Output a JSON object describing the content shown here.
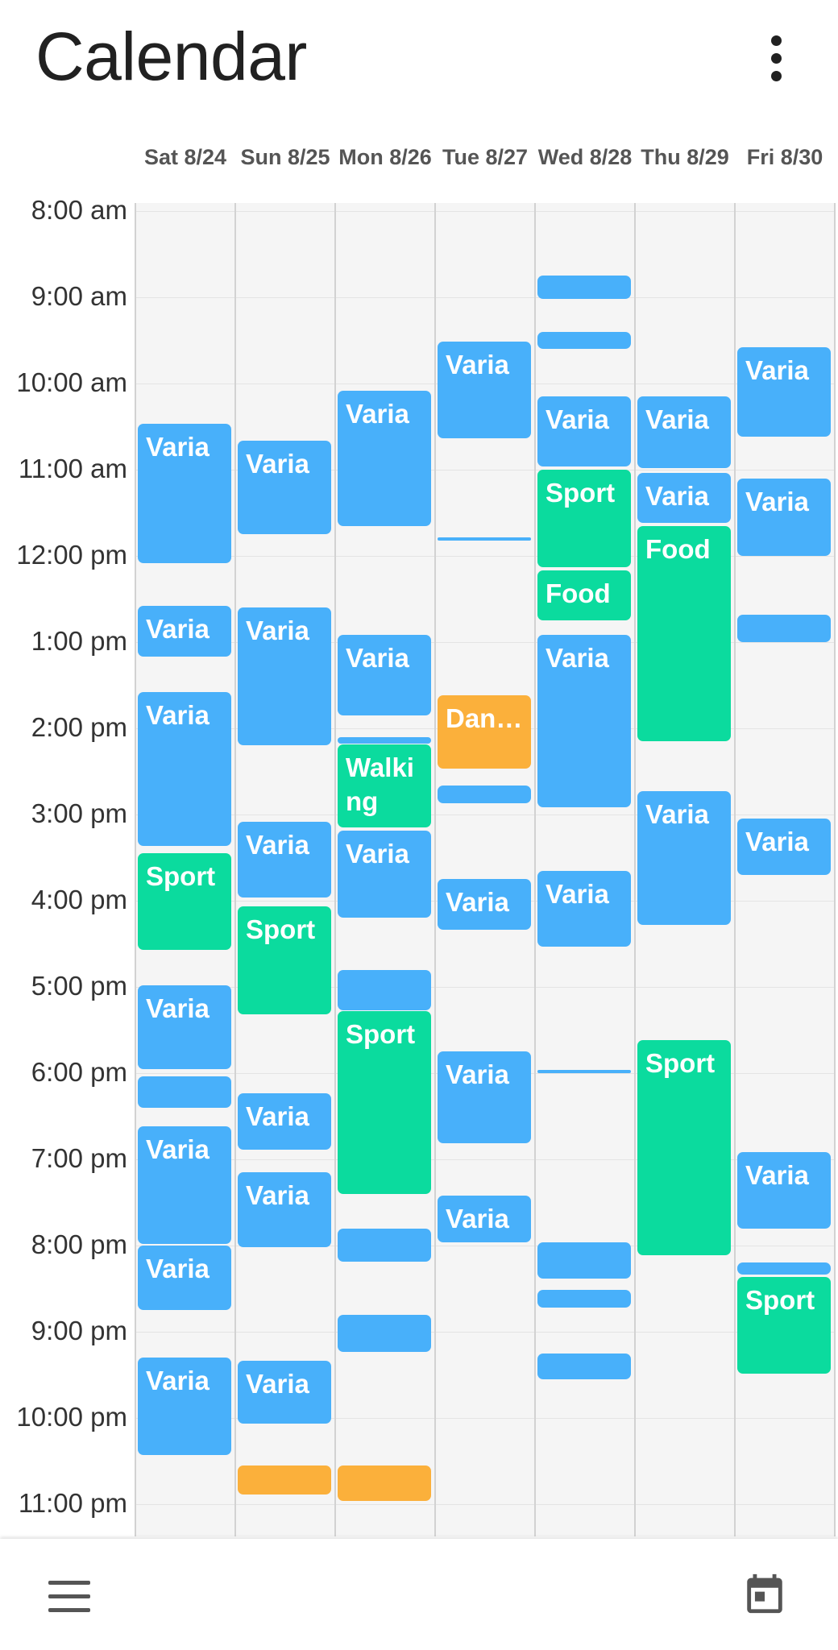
{
  "app": {
    "title": "Calendar"
  },
  "days": [
    "Sat 8/24",
    "Sun 8/25",
    "Mon 8/26",
    "Tue 8/27",
    "Wed 8/28",
    "Thu 8/29",
    "Fri 8/30"
  ],
  "hours": [
    "8:00 am",
    "9:00 am",
    "10:00 am",
    "11:00 am",
    "12:00 pm",
    "1:00 pm",
    "2:00 pm",
    "3:00 pm",
    "4:00 pm",
    "5:00 pm",
    "6:00 pm",
    "7:00 pm",
    "8:00 pm",
    "9:00 pm",
    "10:00 pm",
    "11:00 pm"
  ],
  "colors": {
    "blue": "#48b0fa",
    "green": "#0bdb9e",
    "orange": "#fbb03b"
  },
  "events": [
    {
      "day": 0,
      "start": "10:28",
      "end": "12:05",
      "label": "Varia",
      "color": "blue"
    },
    {
      "day": 0,
      "start": "12:35",
      "end": "13:10",
      "label": "Varia",
      "color": "blue"
    },
    {
      "day": 0,
      "start": "13:35",
      "end": "15:22",
      "label": "Varia",
      "color": "blue"
    },
    {
      "day": 0,
      "start": "15:27",
      "end": "16:34",
      "label": "Sport",
      "color": "green"
    },
    {
      "day": 0,
      "start": "16:59",
      "end": "17:57",
      "label": "Varia",
      "color": "blue"
    },
    {
      "day": 0,
      "start": "18:02",
      "end": "18:24",
      "label": "",
      "color": "blue"
    },
    {
      "day": 0,
      "start": "18:37",
      "end": "19:59",
      "label": "Varia",
      "color": "blue"
    },
    {
      "day": 0,
      "start": "20:00",
      "end": "20:45",
      "label": "Varia",
      "color": "blue"
    },
    {
      "day": 0,
      "start": "21:18",
      "end": "22:26",
      "label": "Varia",
      "color": "blue"
    },
    {
      "day": 1,
      "start": "10:40",
      "end": "11:45",
      "label": "Varia",
      "color": "blue"
    },
    {
      "day": 1,
      "start": "12:36",
      "end": "14:12",
      "label": "Varia",
      "color": "blue"
    },
    {
      "day": 1,
      "start": "15:05",
      "end": "15:58",
      "label": "Varia",
      "color": "blue"
    },
    {
      "day": 1,
      "start": "16:04",
      "end": "17:19",
      "label": "Sport",
      "color": "green"
    },
    {
      "day": 1,
      "start": "18:14",
      "end": "18:53",
      "label": "Varia",
      "color": "blue"
    },
    {
      "day": 1,
      "start": "19:09",
      "end": "20:01",
      "label": "Varia",
      "color": "blue"
    },
    {
      "day": 1,
      "start": "21:20",
      "end": "22:04",
      "label": "Varia",
      "color": "blue"
    },
    {
      "day": 1,
      "start": "22:33",
      "end": "22:53",
      "label": "",
      "color": "orange"
    },
    {
      "day": 2,
      "start": "10:05",
      "end": "11:39",
      "label": "Varia",
      "color": "blue"
    },
    {
      "day": 2,
      "start": "12:55",
      "end": "13:51",
      "label": "Varia",
      "color": "blue"
    },
    {
      "day": 2,
      "start": "14:06",
      "end": "14:09",
      "label": "",
      "color": "blue"
    },
    {
      "day": 2,
      "start": "14:11",
      "end": "15:09",
      "label": "Walking",
      "color": "green",
      "wrap": true
    },
    {
      "day": 2,
      "start": "15:11",
      "end": "16:12",
      "label": "Varia",
      "color": "blue"
    },
    {
      "day": 2,
      "start": "16:48",
      "end": "17:16",
      "label": "",
      "color": "blue"
    },
    {
      "day": 2,
      "start": "17:17",
      "end": "19:24",
      "label": "Sport",
      "color": "green"
    },
    {
      "day": 2,
      "start": "19:48",
      "end": "20:11",
      "label": "",
      "color": "blue"
    },
    {
      "day": 2,
      "start": "20:48",
      "end": "21:14",
      "label": "",
      "color": "blue"
    },
    {
      "day": 2,
      "start": "22:33",
      "end": "22:58",
      "label": "",
      "color": "orange"
    },
    {
      "day": 3,
      "start": "9:31",
      "end": "10:38",
      "label": "Varia",
      "color": "blue"
    },
    {
      "day": 3,
      "start": "11:47",
      "end": "11:49",
      "label": "",
      "color": "blue"
    },
    {
      "day": 3,
      "start": "13:37",
      "end": "14:28",
      "label": "Daniel",
      "color": "orange",
      "ellipsis": true
    },
    {
      "day": 3,
      "start": "14:40",
      "end": "14:52",
      "label": "",
      "color": "blue"
    },
    {
      "day": 3,
      "start": "15:45",
      "end": "16:20",
      "label": "Varia",
      "color": "blue"
    },
    {
      "day": 3,
      "start": "17:45",
      "end": "18:49",
      "label": "Varia",
      "color": "blue"
    },
    {
      "day": 3,
      "start": "19:25",
      "end": "19:58",
      "label": "Varia",
      "color": "blue"
    },
    {
      "day": 4,
      "start": "8:45",
      "end": "9:01",
      "label": "",
      "color": "blue"
    },
    {
      "day": 4,
      "start": "9:24",
      "end": "9:36",
      "label": "",
      "color": "blue"
    },
    {
      "day": 4,
      "start": "10:09",
      "end": "10:58",
      "label": "Varia",
      "color": "blue"
    },
    {
      "day": 4,
      "start": "11:00",
      "end": "12:08",
      "label": "Sport",
      "color": "green"
    },
    {
      "day": 4,
      "start": "12:10",
      "end": "12:45",
      "label": "Food",
      "color": "green"
    },
    {
      "day": 4,
      "start": "12:55",
      "end": "14:55",
      "label": "Varia",
      "color": "blue"
    },
    {
      "day": 4,
      "start": "15:39",
      "end": "16:32",
      "label": "Varia",
      "color": "blue"
    },
    {
      "day": 4,
      "start": "17:58",
      "end": "18:00",
      "label": "",
      "color": "blue"
    },
    {
      "day": 4,
      "start": "19:58",
      "end": "20:23",
      "label": "",
      "color": "blue"
    },
    {
      "day": 4,
      "start": "20:31",
      "end": "20:43",
      "label": "",
      "color": "blue"
    },
    {
      "day": 4,
      "start": "21:15",
      "end": "21:33",
      "label": "",
      "color": "blue"
    },
    {
      "day": 5,
      "start": "10:09",
      "end": "10:59",
      "label": "Varia",
      "color": "blue"
    },
    {
      "day": 5,
      "start": "11:02",
      "end": "11:37",
      "label": "Varia",
      "color": "blue"
    },
    {
      "day": 5,
      "start": "11:39",
      "end": "14:09",
      "label": "Food",
      "color": "green"
    },
    {
      "day": 5,
      "start": "14:44",
      "end": "16:17",
      "label": "Varia",
      "color": "blue"
    },
    {
      "day": 5,
      "start": "17:37",
      "end": "20:07",
      "label": "Sport",
      "color": "green"
    },
    {
      "day": 6,
      "start": "9:35",
      "end": "10:37",
      "label": "Varia",
      "color": "blue"
    },
    {
      "day": 6,
      "start": "11:06",
      "end": "12:00",
      "label": "Varia",
      "color": "blue"
    },
    {
      "day": 6,
      "start": "12:41",
      "end": "13:00",
      "label": "",
      "color": "blue"
    },
    {
      "day": 6,
      "start": "15:03",
      "end": "15:42",
      "label": "Varia",
      "color": "blue"
    },
    {
      "day": 6,
      "start": "18:55",
      "end": "19:48",
      "label": "Varia",
      "color": "blue"
    },
    {
      "day": 6,
      "start": "20:12",
      "end": "20:20",
      "label": "",
      "color": "blue"
    },
    {
      "day": 6,
      "start": "20:22",
      "end": "21:29",
      "label": "Sport",
      "color": "green"
    }
  ],
  "bottom_bar": {
    "menu_icon": "menu-icon",
    "calendar_icon": "calendar-today-icon"
  }
}
